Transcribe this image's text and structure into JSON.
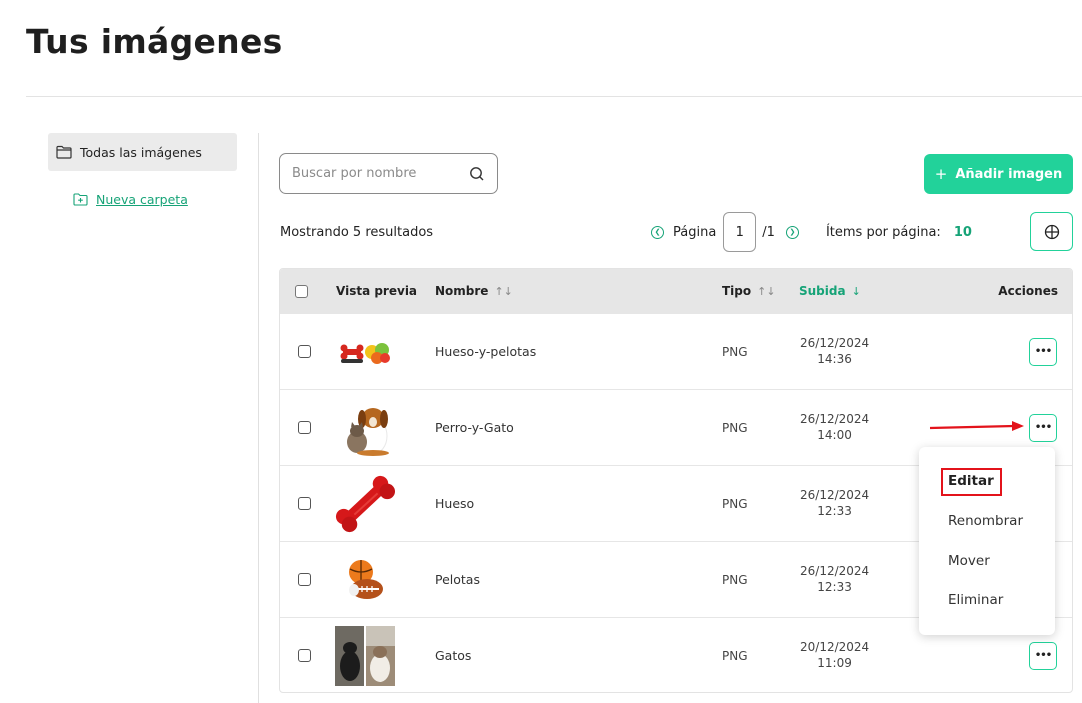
{
  "page": {
    "title": "Tus imágenes"
  },
  "sidebar": {
    "all_images": "Todas las imágenes",
    "new_folder": "Nueva carpeta"
  },
  "search": {
    "placeholder": "Buscar por nombre",
    "value": ""
  },
  "add_button": {
    "label": "Añadir imagen"
  },
  "results_text": "Mostrando 5 resultados",
  "pagination": {
    "page_label": "Página",
    "current_page": "1",
    "total_pages": "/1",
    "items_per_page_label": "Ítems por página:",
    "items_per_page": "10"
  },
  "table": {
    "headers": {
      "preview": "Vista previa",
      "name": "Nombre",
      "type": "Tipo",
      "uploaded": "Subida",
      "actions": "Acciones"
    },
    "rows": [
      {
        "name": "Hueso-y-pelotas",
        "type": "PNG",
        "date": "26/12/2024",
        "time": "14:36",
        "thumb": "bone-and-balls"
      },
      {
        "name": "Perro-y-Gato",
        "type": "PNG",
        "date": "26/12/2024",
        "time": "14:00",
        "thumb": "dog-and-cat"
      },
      {
        "name": "Hueso",
        "type": "PNG",
        "date": "26/12/2024",
        "time": "12:33",
        "thumb": "bone"
      },
      {
        "name": "Pelotas",
        "type": "PNG",
        "date": "26/12/2024",
        "time": "12:33",
        "thumb": "balls"
      },
      {
        "name": "Gatos",
        "type": "PNG",
        "date": "20/12/2024",
        "time": "11:09",
        "thumb": "cats"
      }
    ]
  },
  "context_menu": {
    "items": [
      "Editar",
      "Renombrar",
      "Mover",
      "Eliminar"
    ],
    "highlighted": "Editar"
  },
  "colors": {
    "accent": "#22d29a",
    "accent_text": "#16a377",
    "highlight": "#e3131b"
  }
}
